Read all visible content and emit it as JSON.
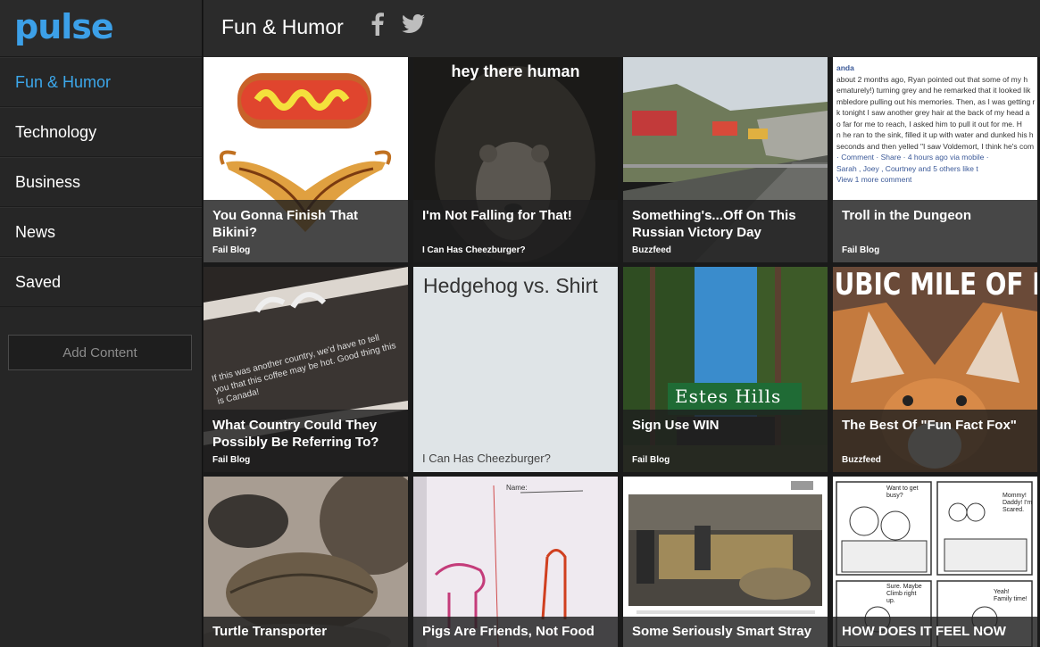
{
  "app": {
    "logo": "pulse"
  },
  "sidebar": {
    "items": [
      {
        "label": "Fun & Humor",
        "active": true
      },
      {
        "label": "Technology",
        "active": false
      },
      {
        "label": "Business",
        "active": false
      },
      {
        "label": "News",
        "active": false
      },
      {
        "label": "Saved",
        "active": false
      }
    ],
    "add_content": "Add Content"
  },
  "header": {
    "title": "Fun & Humor",
    "share_icons": [
      "facebook-icon",
      "twitter-icon"
    ]
  },
  "colors": {
    "accent": "#3ca7ea",
    "sidebar_bg": "#262626",
    "header_bg": "#2b2b2b"
  },
  "tiles": [
    {
      "title": "You Gonna Finish That Bikini?",
      "source": "Fail Blog"
    },
    {
      "title": "I'm Not Falling for That!",
      "source": "I Can Has Cheezburger?",
      "image_text": "hey there human"
    },
    {
      "title": "Something's...Off On This Russian Victory Day",
      "source": "Buzzfeed"
    },
    {
      "title": "Troll in the Dungeon",
      "source": "Fail Blog",
      "image_lines": [
        "anda",
        "about 2 months ago, Ryan pointed out that some of my h",
        "ematurely!) turning grey and he remarked that it looked lik",
        "mbledore pulling out his memories. Then, as I was getting r",
        "k tonight I saw another grey hair at the back of my head a",
        "o far for me to reach, I asked him to pull it out for me. H",
        "n he ran to the sink, filled it up with water and dunked his h",
        "seconds and then yelled \"I saw Voldemort, I think he's com",
        "· Comment · Share · 4 hours ago via mobile ·",
        "Sarah , Joey , Courtney and 5 others like t",
        "View 1 more comment"
      ]
    },
    {
      "title": "What Country Could They Possibly Be Referring To?",
      "source": "Fail Blog",
      "image_text": "If this was another country, we'd have to tell you that this coffee may be hot. Good thing this is Canada!"
    },
    {
      "title": "Hedgehog vs. Shirt",
      "source": "I Can Has Cheezburger?"
    },
    {
      "title": "Sign Use WIN",
      "source": "Fail Blog",
      "image_text": "Estes Hills"
    },
    {
      "title": "The Best Of \"Fun Fact Fox\"",
      "source": "Buzzfeed",
      "image_text": "UBIC MILE OF I"
    },
    {
      "title": "Turtle Transporter",
      "source": ""
    },
    {
      "title": "Pigs Are Friends, Not Food",
      "source": "",
      "image_text": "Name:"
    },
    {
      "title": "Some Seriously Smart Stray",
      "source": ""
    },
    {
      "title": "HOW DOES IT FEEL NOW",
      "source": "",
      "image_texts": [
        "Want to get busy?",
        "Mommy! Daddy! I'm Scared.",
        "Sure. Maybe Climb right up.",
        "Yeah! Family time!"
      ]
    }
  ]
}
